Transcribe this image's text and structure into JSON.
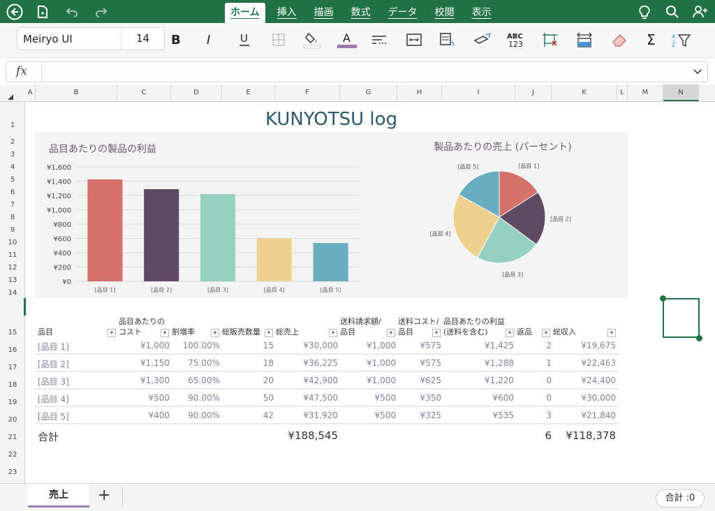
{
  "ribbon_tabs": [
    "ホーム",
    "挿入",
    "描画",
    "数式",
    "データ",
    "校閲",
    "表示"
  ],
  "active_tab": 0,
  "font": {
    "name": "Meiryo UI",
    "size": "14"
  },
  "formula": {
    "fx": "fx",
    "value": ""
  },
  "columns": [
    "A",
    "B",
    "C",
    "D",
    "E",
    "F",
    "G",
    "H",
    "I",
    "J",
    "K",
    "L",
    "M",
    "N"
  ],
  "selected_column": "N",
  "rows": [
    "1",
    "2",
    "3",
    "4",
    "5",
    "6",
    "7",
    "8",
    "9",
    "10",
    "11",
    "12",
    "13",
    "14",
    "15",
    "16",
    "17",
    "18",
    "19",
    "20",
    "21",
    "22",
    "23"
  ],
  "title": "KUNYOTSU log",
  "bar_chart": {
    "title": "品目あたりの製品の利益",
    "yticks": [
      "¥1,600",
      "¥1,400",
      "¥1,200",
      "¥1,000",
      "¥800",
      "¥600",
      "¥400",
      "¥200",
      "¥0"
    ]
  },
  "pie_chart": {
    "title": "製品あたりの売上 (パーセント)",
    "labels": [
      "[品目 1]",
      "[品目 2]",
      "[品目 3]",
      "[品目 4]",
      "[品目 5]"
    ]
  },
  "chart_data": [
    {
      "type": "bar",
      "title": "品目あたりの製品の利益",
      "categories": [
        "[品目 1]",
        "[品目 2]",
        "[品目 3]",
        "[品目 4]",
        "[品目 5]"
      ],
      "values": [
        1425,
        1288,
        1220,
        600,
        535
      ],
      "colors": [
        "#d4716b",
        "#5e4b63",
        "#96d0c0",
        "#edd08f",
        "#6aadc0"
      ],
      "ylim": [
        0,
        1600
      ],
      "grid": true
    },
    {
      "type": "pie",
      "title": "製品あたりの売上 (パーセント)",
      "categories": [
        "[品目 1]",
        "[品目 2]",
        "[品目 3]",
        "[品目 4]",
        "[品目 5]"
      ],
      "values": [
        30000,
        36225,
        42900,
        47500,
        31920
      ],
      "colors": [
        "#d4716b",
        "#5e4b63",
        "#96d0c0",
        "#edd08f",
        "#6aadc0"
      ]
    }
  ],
  "table": {
    "headers": [
      {
        "l1": "",
        "l2": "品目"
      },
      {
        "l1": "品目あたりの",
        "l2": "コスト"
      },
      {
        "l1": "",
        "l2": "割増率"
      },
      {
        "l1": "",
        "l2": "総販売数量"
      },
      {
        "l1": "",
        "l2": "総売上"
      },
      {
        "l1": "送料請求額/",
        "l2": "品目"
      },
      {
        "l1": "送料コスト/",
        "l2": "品目"
      },
      {
        "l1": "品目あたりの利益",
        "l2": "(送料を含む)"
      },
      {
        "l1": "",
        "l2": "返品"
      },
      {
        "l1": "",
        "l2": "総収入"
      }
    ],
    "rows": [
      [
        "[品目 1]",
        "¥1,000",
        "100.00%",
        "15",
        "¥30,000",
        "¥1,000",
        "¥575",
        "¥1,425",
        "2",
        "¥19,675"
      ],
      [
        "[品目 2]",
        "¥1,150",
        "75.00%",
        "18",
        "¥36,225",
        "¥1,000",
        "¥575",
        "¥1,288",
        "1",
        "¥22,463"
      ],
      [
        "[品目 3]",
        "¥1,300",
        "65.00%",
        "20",
        "¥42,900",
        "¥1,000",
        "¥625",
        "¥1,220",
        "0",
        "¥24,400"
      ],
      [
        "[品目 4]",
        "¥500",
        "90.00%",
        "50",
        "¥47,500",
        "¥500",
        "¥350",
        "¥600",
        "0",
        "¥30,000"
      ],
      [
        "[品目 5]",
        "¥400",
        "90.00%",
        "42",
        "¥31,920",
        "¥500",
        "¥325",
        "¥535",
        "3",
        "¥21,840"
      ]
    ],
    "totals": {
      "label": "合計",
      "sales": "¥188,545",
      "returns": "6",
      "revenue": "¥118,378"
    }
  },
  "sheet_tab": "売上",
  "add_sheet": "+",
  "status_sum": "合計 :0"
}
